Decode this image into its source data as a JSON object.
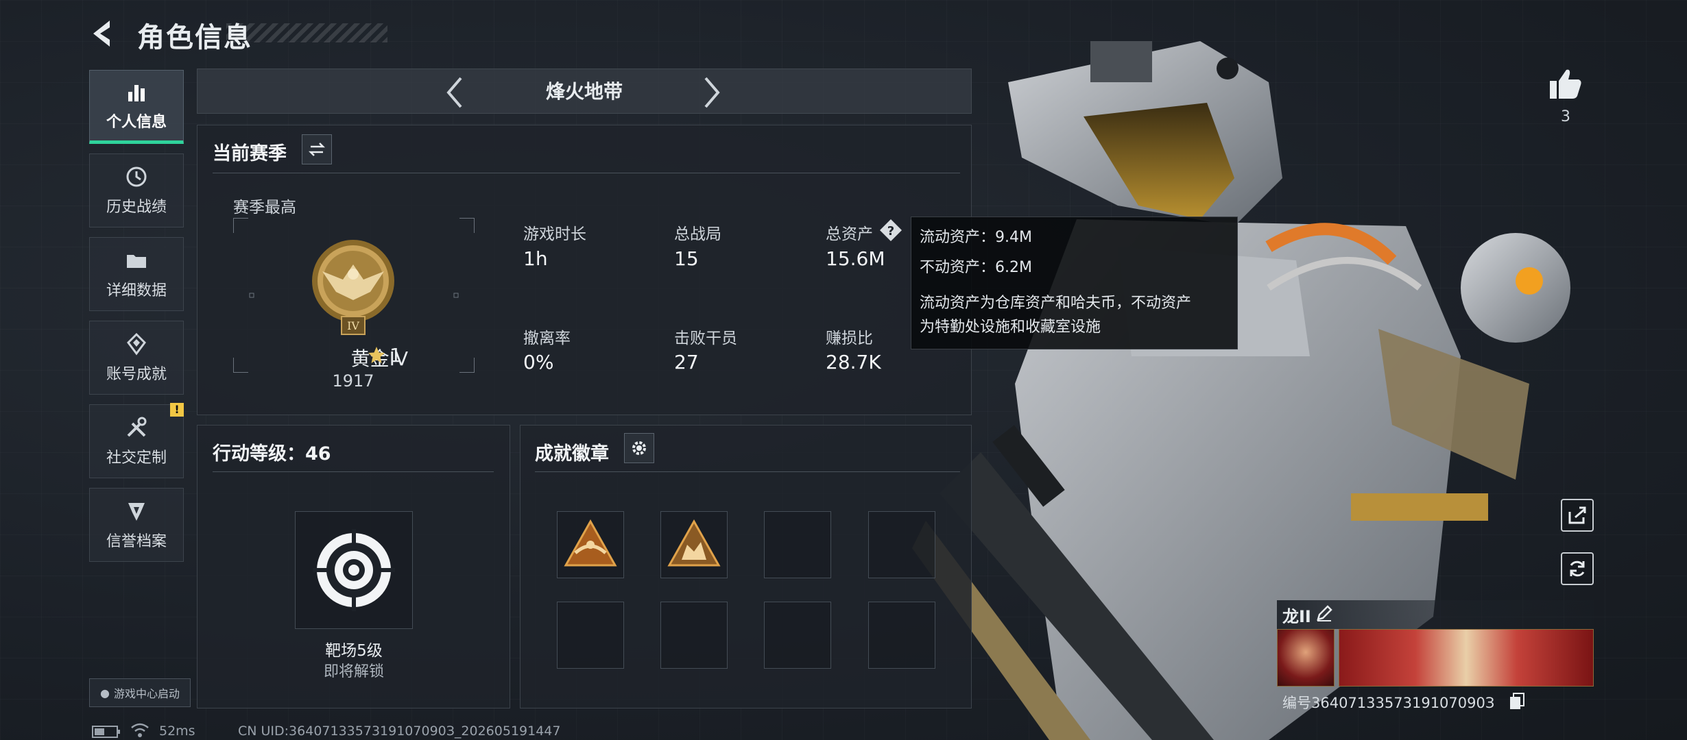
{
  "header": {
    "title": "角色信息"
  },
  "sidebar": {
    "items": [
      {
        "label": "个人信息",
        "icon": "bar-chart-icon",
        "active": true
      },
      {
        "label": "历史战绩",
        "icon": "history-icon",
        "active": false
      },
      {
        "label": "详细数据",
        "icon": "folder-icon",
        "active": false
      },
      {
        "label": "账号成就",
        "icon": "achievement-icon",
        "active": false
      },
      {
        "label": "社交定制",
        "icon": "tools-icon",
        "active": false,
        "badge": "!"
      },
      {
        "label": "信誉档案",
        "icon": "shield-icon",
        "active": false
      }
    ],
    "game_center": "游戏中心启动"
  },
  "mode": {
    "label": "烽火地带"
  },
  "season": {
    "title": "当前赛季",
    "best_label": "赛季最高",
    "rank_name": "黄金IV",
    "rank_stars": "1",
    "rank_emblem_numeral": "IV",
    "rank_score": "1917",
    "stats": [
      {
        "label": "游戏时长",
        "value": "1h"
      },
      {
        "label": "总战局",
        "value": "15"
      },
      {
        "label": "总资产",
        "value": "15.6M"
      },
      {
        "label": "撤离率",
        "value": "0%"
      },
      {
        "label": "击败干员",
        "value": "27"
      },
      {
        "label": "赚损比",
        "value": "28.7K"
      }
    ]
  },
  "tooltip": {
    "line1": "流动资产：9.4M",
    "line2": "不动资产：6.2M",
    "desc1": "流动资产为仓库资产和哈夫币，不动资产",
    "desc2": "为特勤处设施和收藏室设施"
  },
  "action_level": {
    "title": "行动等级：46",
    "unlock_name": "靶场5级",
    "unlock_status": "即将解锁"
  },
  "achievements": {
    "title": "成就徽章"
  },
  "likes": {
    "count": "3"
  },
  "player": {
    "name": "龙II",
    "id_text": "编号3640713357319107090З"
  },
  "status_bar": {
    "ping": "52ms",
    "uid": "CN UID:3640713357319107090З_202605191447"
  },
  "colors": {
    "accent_green": "#2fd39b",
    "warning": "#f2c744",
    "gold": "#c9a35a"
  }
}
